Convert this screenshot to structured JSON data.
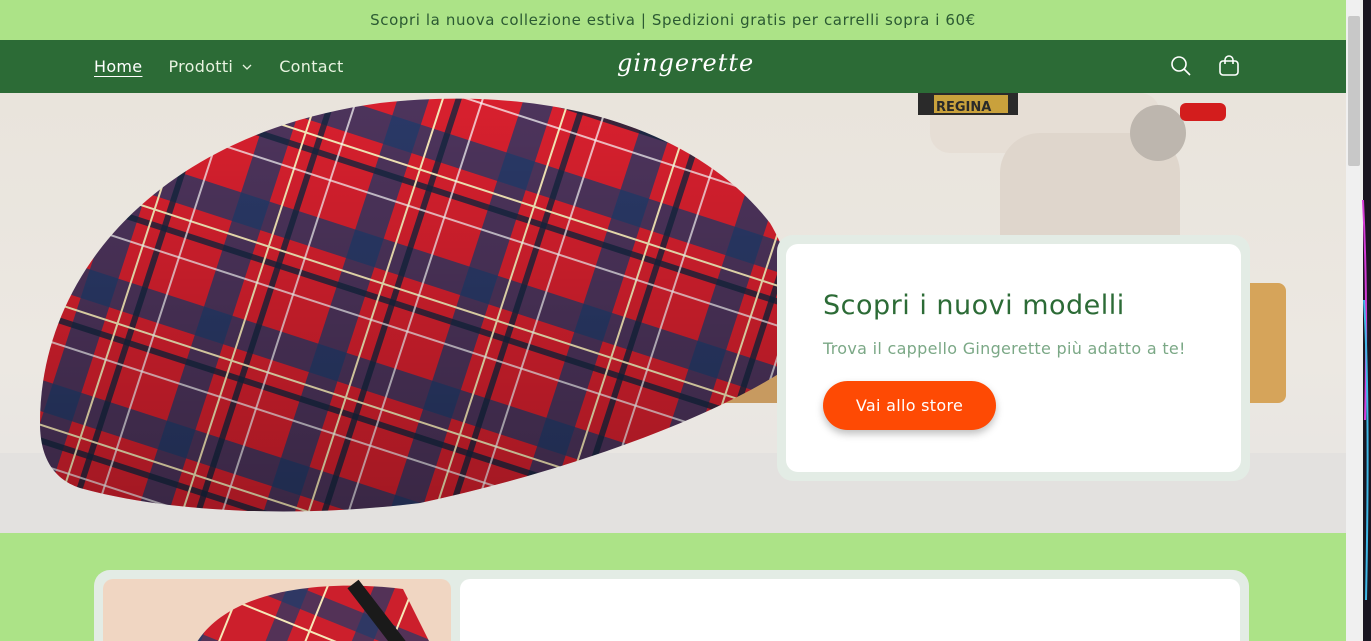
{
  "announcement": {
    "text": "Scopri la nuova collezione estiva | Spedizioni gratis per carrelli sopra i 60€"
  },
  "header": {
    "nav": [
      {
        "label": "Home",
        "active": true
      },
      {
        "label": "Prodotti",
        "has_dropdown": true
      },
      {
        "label": "Contact"
      }
    ],
    "logo": "gingerette",
    "icons": [
      "search-icon",
      "cart-icon"
    ]
  },
  "hero": {
    "title": "Scopri i nuovi modelli",
    "subtitle": "Trova il cappello Gingerette più adatto a te!",
    "button_label": "Vai allo store"
  },
  "colors": {
    "accent": "#fe4a04",
    "header_bg": "#2c6b36",
    "announcement_bg": "#ace387",
    "title_color": "#2c6b36"
  }
}
